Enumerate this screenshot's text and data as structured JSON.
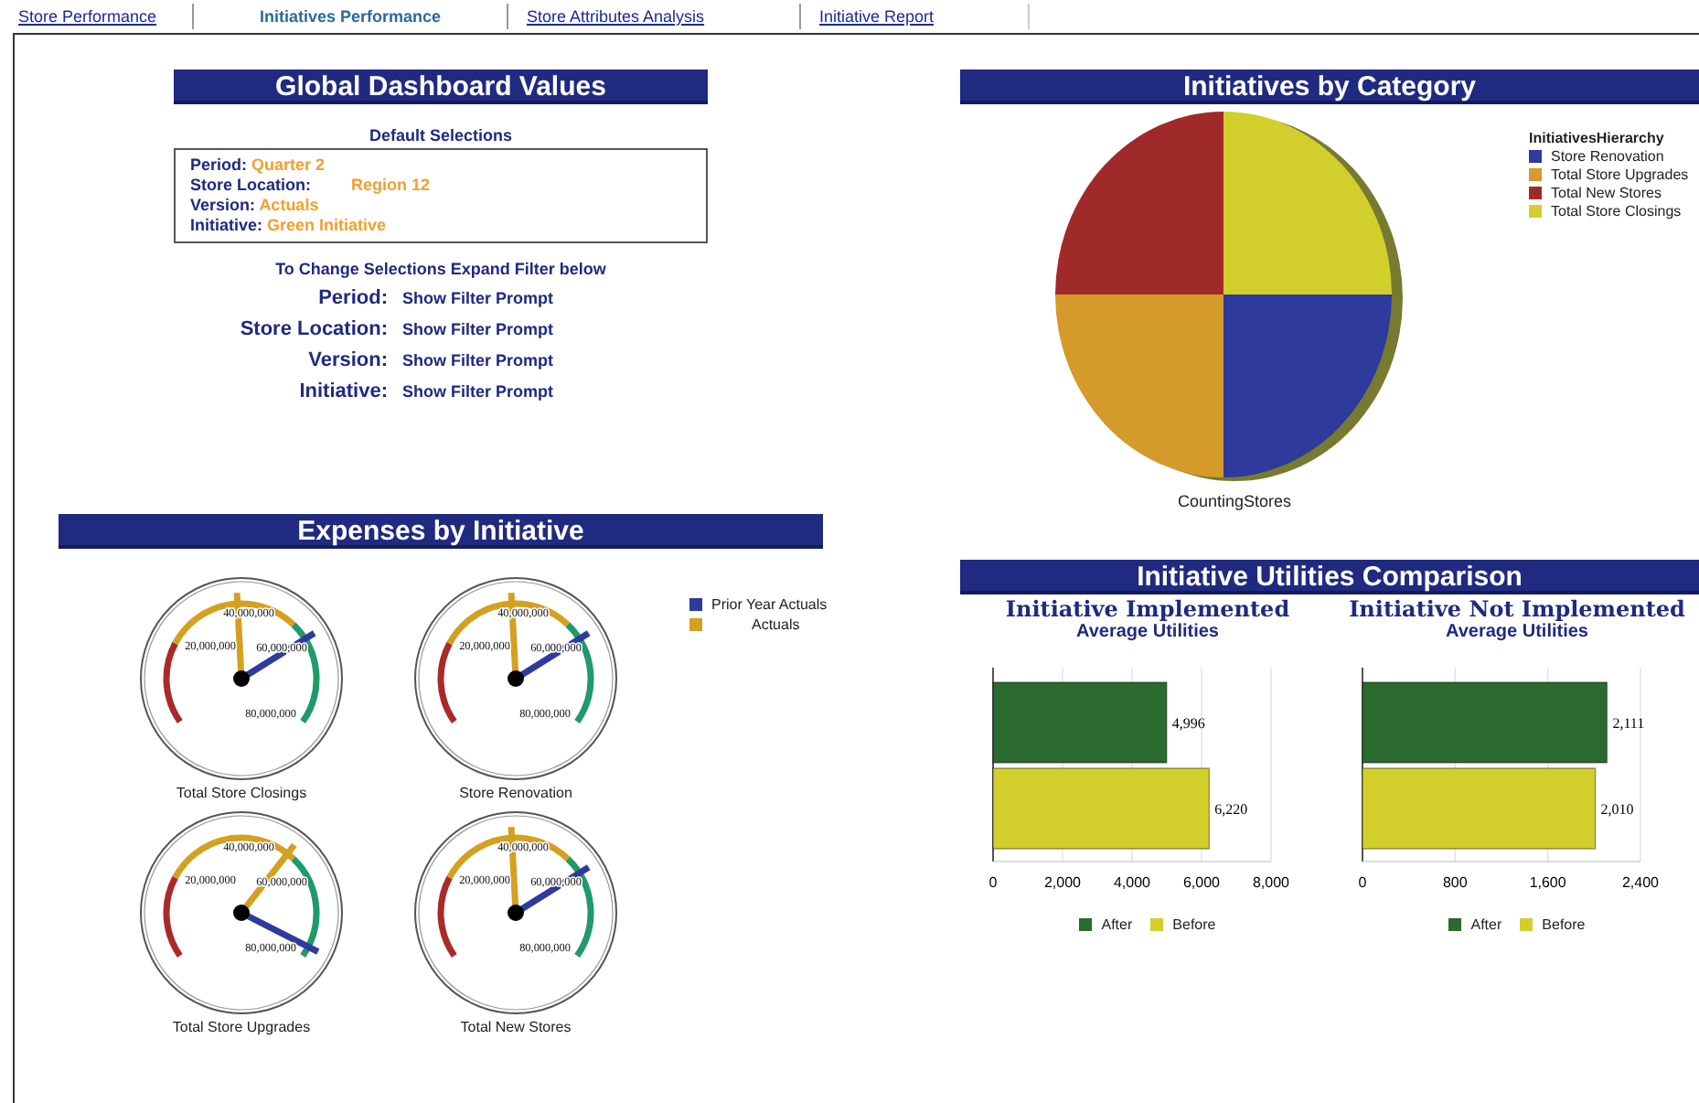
{
  "tabs": [
    {
      "label": "Store Performance",
      "selected": false
    },
    {
      "label": "Initiatives Performance",
      "selected": true
    },
    {
      "label": "Store Attributes Analysis",
      "selected": false
    },
    {
      "label": "Initiative Report",
      "selected": false
    }
  ],
  "dashboard_values": {
    "title": "Global Dashboard Values",
    "default_selections": {
      "title": "Default Selections",
      "items": [
        {
          "label": "Period:",
          "value": "Quarter 2"
        },
        {
          "label": "Store Location:",
          "value": "Region 12"
        },
        {
          "label": "Version:",
          "value": "Actuals"
        },
        {
          "label": "Initiative:",
          "value": "Green Initiative"
        }
      ]
    },
    "change_hint": "To Change Selections Expand Filter below",
    "filters": [
      {
        "label": "Period:",
        "link": "Show Filter Prompt"
      },
      {
        "label": "Store Location:",
        "link": "Show Filter Prompt"
      },
      {
        "label": "Version:",
        "link": "Show Filter Prompt"
      },
      {
        "label": "Initiative:",
        "link": "Show Filter Prompt"
      }
    ]
  },
  "initiatives_by_category": {
    "title": "Initiatives by Category",
    "caption": "CountingStores",
    "legend": {
      "title": "InitiativesHierarchy",
      "items": [
        {
          "label": "Store Renovation",
          "color": "#2e3a9c"
        },
        {
          "label": "Total Store Upgrades",
          "color": "#d49a2a"
        },
        {
          "label": "Total New Stores",
          "color": "#a02a2a"
        },
        {
          "label": "Total Store Closings",
          "color": "#d2cf2c"
        }
      ]
    }
  },
  "expenses_by_initiative": {
    "title": "Expenses by Initiative",
    "legend": [
      {
        "label": "Prior Year Actuals",
        "color": "#2e3a9c"
      },
      {
        "label": "Actuals",
        "color": "#d4a020"
      }
    ],
    "gauges": [
      {
        "title": "Total Store Closings",
        "scale_labels": [
          "20,000,000",
          "40,000,000",
          "60,000,000",
          "80,000,000"
        ],
        "kind": "gauge"
      },
      {
        "title": "Store Renovation",
        "scale_labels": [
          "20,000,000",
          "40,000,000",
          "60,000,000",
          "80,000,000"
        ],
        "kind": "gauge"
      },
      {
        "title": "Total Store Upgrades",
        "scale_labels": [
          "20,000,000",
          "40,000,000",
          "60,000,000",
          "80,000,000"
        ],
        "kind": "gauge"
      },
      {
        "title": "Total New Stores",
        "scale_labels": [
          "20,000,000",
          "40,000,000",
          "60,000,000",
          "80,000,000"
        ],
        "kind": "gauge"
      }
    ]
  },
  "utilities_comparison": {
    "title": "Initiative Utilities Comparison",
    "charts": [
      {
        "title": "Initiative Implemented",
        "subtitle": "Average Utilities",
        "chart_data": {
          "type": "bar",
          "orientation": "horizontal",
          "series": [
            {
              "name": "After",
              "color": "#2b6b2f",
              "values": [
                4996
              ]
            },
            {
              "name": "Before",
              "color": "#d2cf2c",
              "values": [
                6220
              ]
            }
          ],
          "xlim": [
            0,
            8000
          ],
          "xticks": [
            {
              "value": 0,
              "label": "0"
            },
            {
              "value": 2000,
              "label": "2,000"
            },
            {
              "value": 4000,
              "label": "4,000"
            },
            {
              "value": 6000,
              "label": "6,000"
            },
            {
              "value": 8000,
              "label": "8,000"
            }
          ],
          "grid": true,
          "value_labels": [
            "4,996",
            "6,220"
          ]
        }
      },
      {
        "title": "Initiative Not Implemented",
        "subtitle": "Average Utilities",
        "chart_data": {
          "type": "bar",
          "orientation": "horizontal",
          "series": [
            {
              "name": "After",
              "color": "#2b6b2f",
              "values": [
                2111
              ]
            },
            {
              "name": "Before",
              "color": "#d2cf2c",
              "values": [
                2010
              ]
            }
          ],
          "xlim": [
            0,
            2400
          ],
          "xticks": [
            {
              "value": 0,
              "label": "0"
            },
            {
              "value": 800,
              "label": "800"
            },
            {
              "value": 1600,
              "label": "1,600"
            },
            {
              "value": 2400,
              "label": "2,400"
            }
          ],
          "grid": true,
          "value_labels": [
            "2,111",
            "2,010"
          ]
        }
      }
    ]
  }
}
